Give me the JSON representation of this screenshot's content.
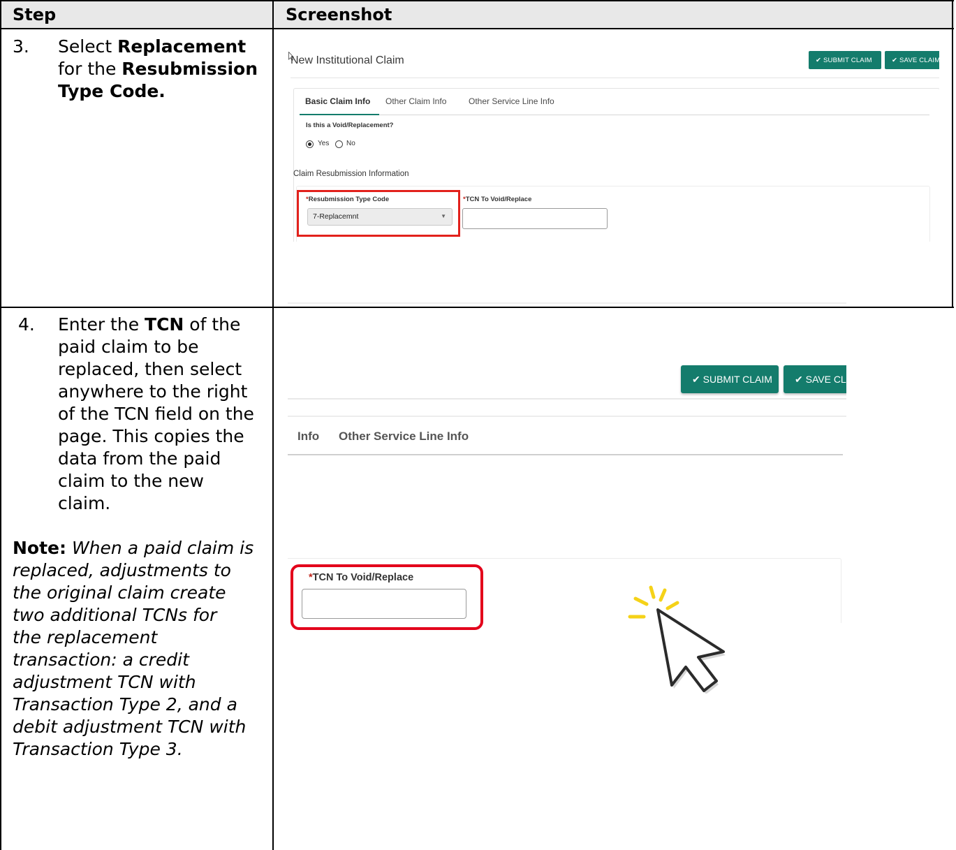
{
  "table": {
    "header_step": "Step",
    "header_screenshot": "Screenshot"
  },
  "rows": [
    {
      "number": "3.",
      "text_parts": [
        {
          "t": "Select ",
          "bold": false
        },
        {
          "t": "Replacement",
          "bold": true
        },
        {
          "t": " for the ",
          "bold": false
        },
        {
          "t": "Resubmission Type Code.",
          "bold": true
        }
      ],
      "lines": [
        [
          {
            "t": "Select ",
            "b": false
          },
          {
            "t": "Replacement",
            "b": true
          }
        ],
        [
          {
            "t": "for the ",
            "b": false
          },
          {
            "t": "Resubmission",
            "b": true
          }
        ],
        [
          {
            "t": "Type Code.",
            "b": true
          }
        ]
      ]
    },
    {
      "number": "4.",
      "lines": [
        [
          {
            "t": "Enter the ",
            "b": false
          },
          {
            "t": "TCN",
            "b": true
          },
          {
            "t": " of the",
            "b": false
          }
        ],
        [
          {
            "t": "paid claim to be",
            "b": false
          }
        ],
        [
          {
            "t": "replaced, then select",
            "b": false
          }
        ],
        [
          {
            "t": "anywhere to the right",
            "b": false
          }
        ],
        [
          {
            "t": "of the TCN field on the",
            "b": false
          }
        ],
        [
          {
            "t": "page. This copies the",
            "b": false
          }
        ],
        [
          {
            "t": "data from the paid",
            "b": false
          }
        ],
        [
          {
            "t": "claim to the new",
            "b": false
          }
        ],
        [
          {
            "t": "claim.",
            "b": false
          }
        ]
      ],
      "note_label": "Note:",
      "note_lines": [
        " When a paid claim is",
        "replaced, adjustments to",
        "the original claim create",
        "two additional TCNs for",
        "the replacement",
        "transaction: a credit",
        "adjustment TCN with",
        "Transaction Type 2, and a",
        "debit adjustment TCN with",
        "Transaction Type 3."
      ]
    }
  ],
  "screenshot1": {
    "page_title": "New Institutional Claim",
    "submit_button": "✔ SUBMIT CLAIM",
    "save_button": "✔ SAVE CLAIM",
    "tabs": [
      "Basic Claim Info",
      "Other Claim Info",
      "Other Service Line Info"
    ],
    "void_question": "Is this a Void/Replacement?",
    "radio_yes": "Yes",
    "radio_no": "No",
    "radio_selected": "Yes",
    "section_title": "Claim Resubmission Information",
    "resubmission_label": "Resubmission Type Code",
    "resubmission_value": "7-Replacemnt",
    "tcn_label": "TCN To Void/Replace",
    "tcn_value": "",
    "required_mark": "*",
    "highlight_color": "#e2211c",
    "accent_color": "#147c6c"
  },
  "screenshot2": {
    "submit_button": "✔ SUBMIT CLAIM",
    "save_button": "✔ SAVE CLA",
    "tab_partial": "Info",
    "tab_other_service": "Other Service Line Info",
    "tcn_label": "TCN To Void/Replace",
    "tcn_value": "",
    "required_mark": "*",
    "highlight_color": "#e3001b",
    "cursor_icon": "click-cursor-icon"
  }
}
